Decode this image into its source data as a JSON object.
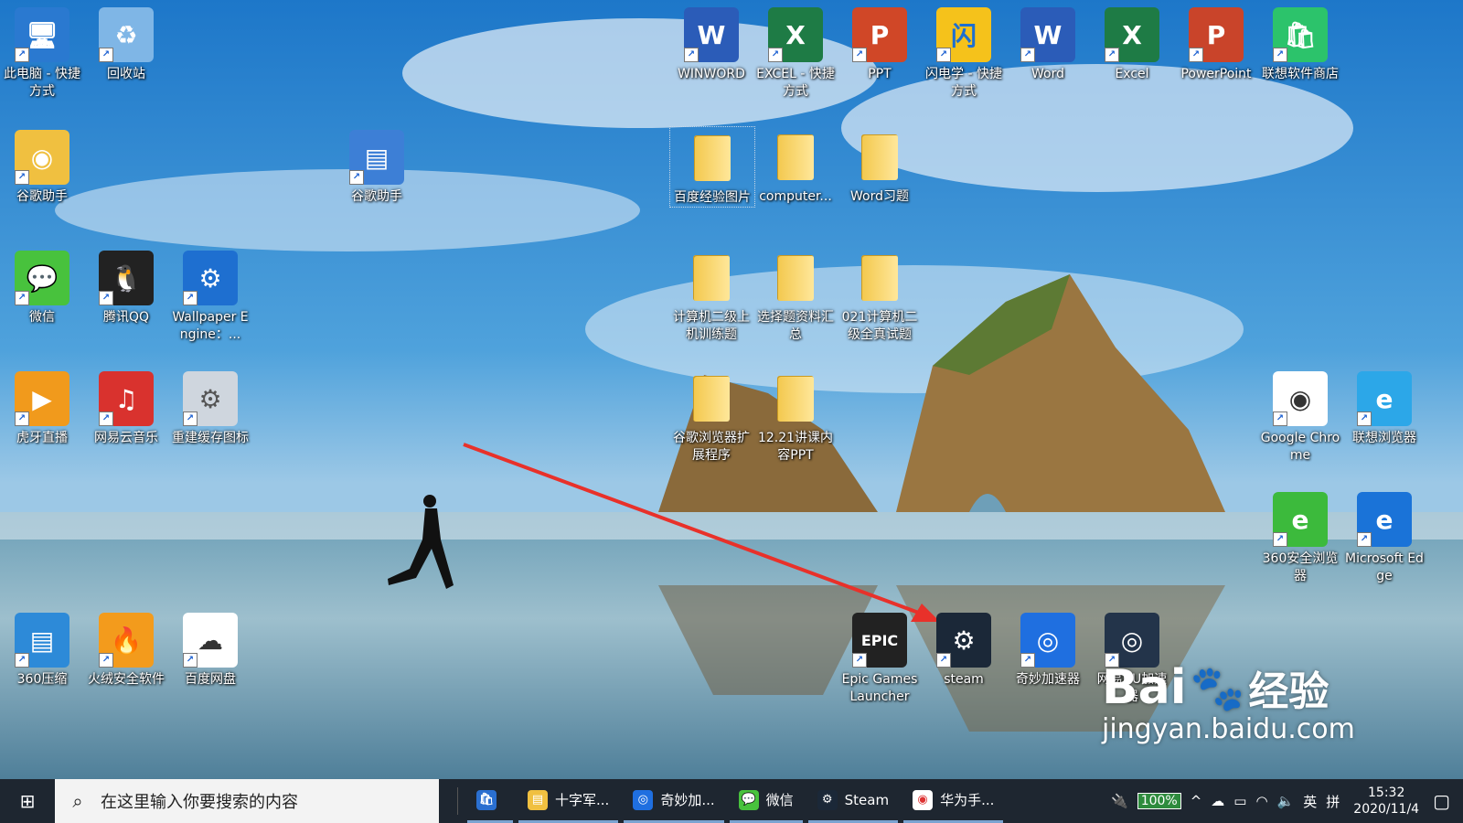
{
  "desktop": {
    "icons": [
      {
        "id": "this-pc",
        "label": "此电脑 - 快捷方式",
        "glyph": "🖥"
      },
      {
        "id": "recycle-bin",
        "label": "回收站",
        "glyph": "♻"
      },
      {
        "id": "chrome-helper-1",
        "label": "谷歌助手",
        "glyph": "◉"
      },
      {
        "id": "chrome-helper-2",
        "label": "谷歌助手",
        "glyph": "▤"
      },
      {
        "id": "wechat",
        "label": "微信",
        "glyph": "💬"
      },
      {
        "id": "qq",
        "label": "腾讯QQ",
        "glyph": "🐧"
      },
      {
        "id": "wallpaper-engine",
        "label": "Wallpaper Engine：...",
        "glyph": "⚙"
      },
      {
        "id": "huya",
        "label": "虎牙直播",
        "glyph": "▶"
      },
      {
        "id": "netease-music",
        "label": "网易云音乐",
        "glyph": "♫"
      },
      {
        "id": "rebuild-cache",
        "label": "重建缓存图标",
        "glyph": "⚙"
      },
      {
        "id": "360zip",
        "label": "360压缩",
        "glyph": "▤"
      },
      {
        "id": "huorong",
        "label": "火绒安全软件",
        "glyph": "🔥"
      },
      {
        "id": "baidu-pan",
        "label": "百度网盘",
        "glyph": "☁"
      },
      {
        "id": "winword",
        "label": "WINWORD",
        "glyph": "W"
      },
      {
        "id": "excel-shortcut",
        "label": "EXCEL - 快捷方式",
        "glyph": "X"
      },
      {
        "id": "ppt",
        "label": "PPT",
        "glyph": "P"
      },
      {
        "id": "shandianxue",
        "label": "闪电学 - 快捷方式",
        "glyph": "闪"
      },
      {
        "id": "word",
        "label": "Word",
        "glyph": "W"
      },
      {
        "id": "excel",
        "label": "Excel",
        "glyph": "X"
      },
      {
        "id": "powerpoint",
        "label": "PowerPoint",
        "glyph": "P"
      },
      {
        "id": "lenovo-store",
        "label": "联想软件商店",
        "glyph": "🛍"
      },
      {
        "id": "folder-baidu-images",
        "label": "百度经验图片",
        "glyph": ""
      },
      {
        "id": "folder-computer",
        "label": "computer...",
        "glyph": ""
      },
      {
        "id": "folder-word-exercises",
        "label": "Word习题",
        "glyph": ""
      },
      {
        "id": "folder-computer-practice",
        "label": "计算机二级上机训练题",
        "glyph": ""
      },
      {
        "id": "folder-choice-questions",
        "label": "选择题资料汇总",
        "glyph": ""
      },
      {
        "id": "folder-021",
        "label": "021计算机二级全真试题",
        "glyph": ""
      },
      {
        "id": "folder-chrome-ext",
        "label": "谷歌浏览器扩展程序",
        "glyph": ""
      },
      {
        "id": "folder-1221",
        "label": "12.21讲课内容PPT",
        "glyph": ""
      },
      {
        "id": "google-chrome",
        "label": "Google Chrome",
        "glyph": "◉"
      },
      {
        "id": "lenovo-browser",
        "label": "联想浏览器",
        "glyph": "e"
      },
      {
        "id": "360-browser",
        "label": "360安全浏览器",
        "glyph": "e"
      },
      {
        "id": "microsoft-edge",
        "label": "Microsoft Edge",
        "glyph": "e"
      },
      {
        "id": "epic-games",
        "label": "Epic Games Launcher",
        "glyph": "EPIC"
      },
      {
        "id": "steam",
        "label": "steam",
        "glyph": "⚙"
      },
      {
        "id": "qimiao",
        "label": "奇妙加速器",
        "glyph": "◎"
      },
      {
        "id": "netease-uu",
        "label": "网易UU加速器",
        "glyph": "◎"
      }
    ]
  },
  "taskbar": {
    "start_glyph": "⊞",
    "search_placeholder": "在这里输入你要搜索的内容",
    "apps": [
      {
        "label": "",
        "glyph": "🛍"
      },
      {
        "label": "十字军...",
        "glyph": "▤"
      },
      {
        "label": "奇妙加...",
        "glyph": "◎"
      },
      {
        "label": "微信",
        "glyph": "💬"
      },
      {
        "label": "Steam",
        "glyph": "⚙"
      },
      {
        "label": "华为手...",
        "glyph": "◉"
      }
    ],
    "battery": "100%",
    "ime": "英",
    "ime_mode": "拼",
    "time": "15:32",
    "date": "2020/11/4"
  },
  "watermark": {
    "brand": "Bai",
    "brand_tail": "经验",
    "url": "jingyan.baidu.com"
  },
  "colors": {
    "arrow": "#e8312a",
    "taskbar": "#1e2630"
  }
}
